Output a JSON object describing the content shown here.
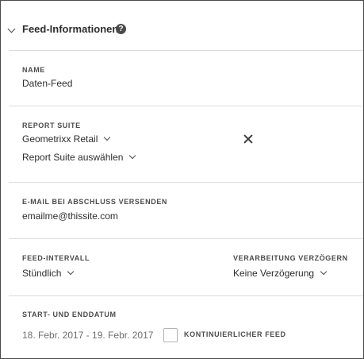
{
  "section": {
    "title": "Feed-Informationen",
    "help_icon": "?"
  },
  "name": {
    "label": "NAME",
    "value": "Daten-Feed"
  },
  "report_suite": {
    "label": "REPORT SUITE",
    "selected": "Geometrixx Retail",
    "add_label": "Report Suite auswählen"
  },
  "email": {
    "label": "E-MAIL BEI ABSCHLUSS VERSENDEN",
    "value": "emailme@thissite.com"
  },
  "interval": {
    "label": "FEED-INTERVALL",
    "value": "Stündlich"
  },
  "delay": {
    "label": "VERARBEITUNG VERZÖGERN",
    "value": "Keine Verzögerung"
  },
  "dates": {
    "label": "START- UND ENDDATUM",
    "value": "18. Febr. 2017 - 19. Febr. 2017",
    "continuous_label": "KONTINUIERLICHER FEED",
    "continuous_checked": false
  },
  "icons": [
    "chevron-down-icon",
    "help-icon",
    "close-icon",
    "caret-down-icon"
  ]
}
